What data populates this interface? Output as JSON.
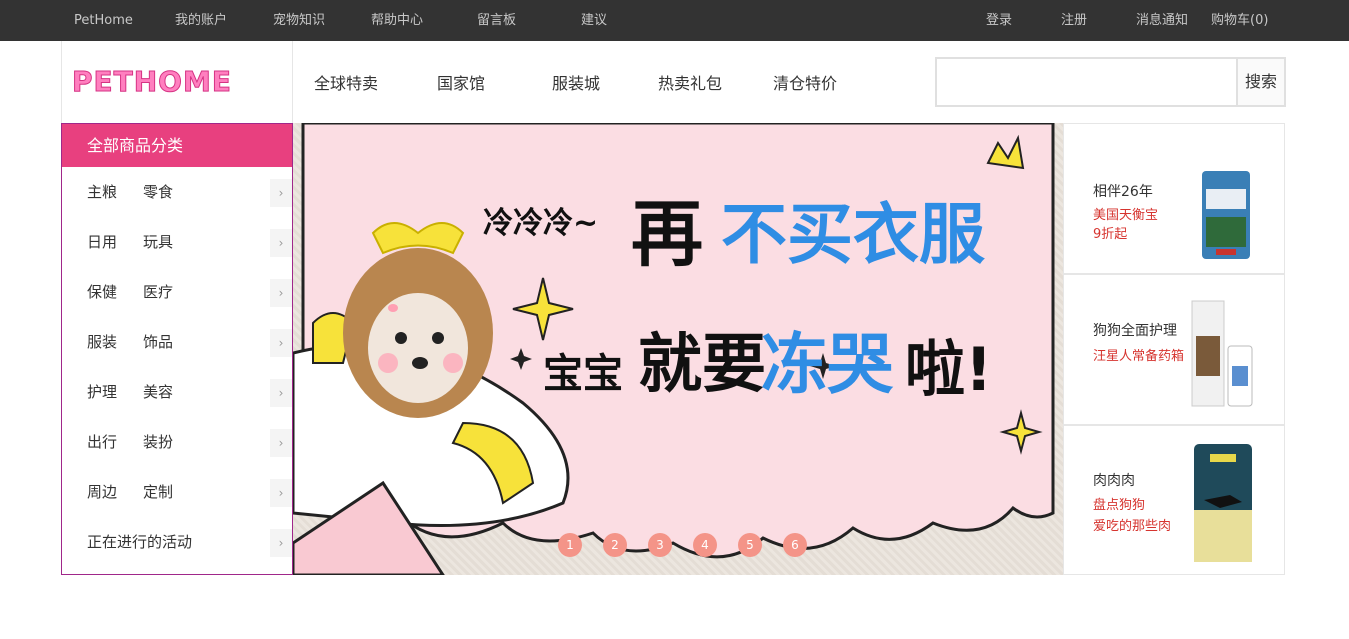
{
  "topbar": {
    "brand": "PetHome",
    "links": [
      "我的账户",
      "宠物知识",
      "帮助中心",
      "留言板",
      "建议"
    ],
    "right": [
      "登录",
      "注册",
      "消息通知",
      "购物车(0)"
    ]
  },
  "logo": {
    "text": "PETHOME"
  },
  "nav": [
    "全球特卖",
    "国家馆",
    "服装城",
    "热卖礼包",
    "清仓特价"
  ],
  "search": {
    "button_label": "搜索",
    "value": ""
  },
  "categories": {
    "title": "全部商品分类",
    "items": [
      {
        "a": "主粮",
        "b": "零食"
      },
      {
        "a": "日用",
        "b": "玩具"
      },
      {
        "a": "保健",
        "b": "医疗"
      },
      {
        "a": "服装",
        "b": "饰品"
      },
      {
        "a": "护理",
        "b": "美容"
      },
      {
        "a": "出行",
        "b": "装扮"
      },
      {
        "a": "周边",
        "b": "定制"
      },
      {
        "a": "正在进行的活动",
        "b": ""
      }
    ],
    "arrow": "›"
  },
  "banner": {
    "line1_small": "冷冷冷~",
    "line1_black": "再",
    "line1_blue": "不买衣服",
    "line2_small": "宝宝",
    "line2_black": "就要",
    "line2_blue": "冻哭",
    "line2_end": "啦!",
    "dots": [
      "1",
      "2",
      "3",
      "4",
      "5",
      "6"
    ],
    "colors": {
      "pink": "#fbdde3",
      "blue": "#2f8de4",
      "dot": "#f49488",
      "yellow": "#f7e23a"
    }
  },
  "promos": [
    {
      "title": "相伴26年",
      "sub1": "美国天衡宝",
      "sub2": "9折起"
    },
    {
      "title": "狗狗全面护理",
      "sub1": "汪星人常备药箱",
      "sub2": ""
    },
    {
      "title": "肉肉肉",
      "sub1": "盘点狗狗",
      "sub2": "爱吃的那些肉"
    }
  ],
  "colors": {
    "topbar": "#333333",
    "accent": "#e8407f",
    "sidebar_border": "#a0278a",
    "promo_red": "#d6342f"
  }
}
